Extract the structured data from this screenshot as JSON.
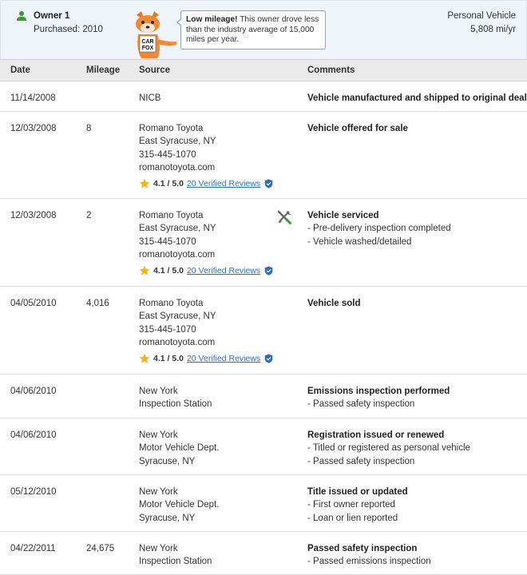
{
  "owner": {
    "title": "Owner 1",
    "purchased": "Purchased: 2010",
    "mascot_icon": "carfox-mascot-icon",
    "mascot_text_top": "CAR",
    "mascot_text_bottom": "FOX",
    "bubble_bold": "Low mileage!",
    "bubble_text": " This owner drove less than the industry average of 15,000 miles per year.",
    "vehicle_type": "Personal Vehicle",
    "miles_per_year": "5,808 mi/yr",
    "accent_color": "#3a9a3a"
  },
  "columns": {
    "date": "Date",
    "mileage": "Mileage",
    "source": "Source",
    "comments": "Comments"
  },
  "records": [
    {
      "date": "11/14/2008",
      "mileage": "",
      "source": [
        "NICB"
      ],
      "rating": null,
      "icon": null,
      "comment_title": "Vehicle manufactured and shipped to original dealer",
      "comment_lines": []
    },
    {
      "date": "12/03/2008",
      "mileage": "8",
      "source": [
        "Romano Toyota",
        "East Syracuse, NY",
        "315-445-1070",
        "romanotoyota.com"
      ],
      "rating": {
        "value": "4.1 / 5.0",
        "reviews": "20 Verified Reviews"
      },
      "icon": null,
      "comment_title": "Vehicle offered for sale",
      "comment_lines": []
    },
    {
      "date": "12/03/2008",
      "mileage": "2",
      "source": [
        "Romano Toyota",
        "East Syracuse, NY",
        "315-445-1070",
        "romanotoyota.com"
      ],
      "rating": {
        "value": "4.1 / 5.0",
        "reviews": "20 Verified Reviews"
      },
      "icon": "service-tools-icon",
      "comment_title": "Vehicle serviced",
      "comment_lines": [
        "- Pre-delivery inspection completed",
        "- Vehicle washed/detailed"
      ]
    },
    {
      "date": "04/05/2010",
      "mileage": "4,016",
      "source": [
        "Romano Toyota",
        "East Syracuse, NY",
        "315-445-1070",
        "romanotoyota.com"
      ],
      "rating": {
        "value": "4.1 / 5.0",
        "reviews": "20 Verified Reviews"
      },
      "icon": null,
      "comment_title": "Vehicle sold",
      "comment_lines": []
    },
    {
      "date": "04/06/2010",
      "mileage": "",
      "source": [
        "New York",
        "Inspection Station"
      ],
      "rating": null,
      "icon": null,
      "comment_title": "Emissions inspection performed",
      "comment_lines": [
        "- Passed safety inspection"
      ]
    },
    {
      "date": "04/06/2010",
      "mileage": "",
      "source": [
        "New York",
        "Motor Vehicle Dept.",
        "Syracuse, NY"
      ],
      "rating": null,
      "icon": null,
      "comment_title": "Registration issued or renewed",
      "comment_lines": [
        "- Titled or registered as personal vehicle",
        "- Passed safety inspection"
      ]
    },
    {
      "date": "05/12/2010",
      "mileage": "",
      "source": [
        "New York",
        "Motor Vehicle Dept.",
        "Syracuse, NY"
      ],
      "rating": null,
      "icon": null,
      "comment_title": "Title issued or updated",
      "comment_lines": [
        "- First owner reported",
        "- Loan or lien reported"
      ]
    },
    {
      "date": "04/22/2011",
      "mileage": "24,675",
      "source": [
        "New York",
        "Inspection Station"
      ],
      "rating": null,
      "icon": null,
      "comment_title": "Passed safety inspection",
      "comment_lines": [
        "- Passed emissions inspection"
      ]
    }
  ]
}
